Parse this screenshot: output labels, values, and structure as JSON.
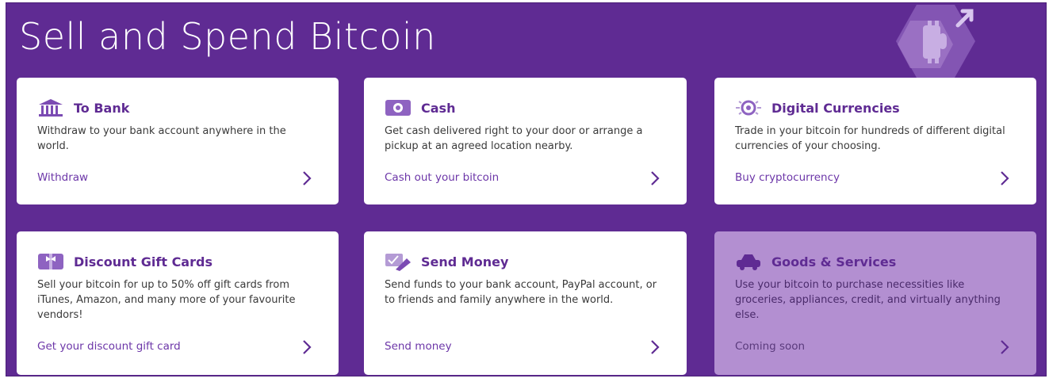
{
  "header": {
    "title": "Sell and Spend Bitcoin"
  },
  "colors": {
    "panel": "#5f2b93",
    "accent": "#6c36a8",
    "card": "#ffffff",
    "card_disabled": "#b38fd1"
  },
  "cards": [
    {
      "icon": "bank-icon",
      "title": "To Bank",
      "description": "Withdraw to your bank account anywhere in the world.",
      "link": "Withdraw"
    },
    {
      "icon": "cash-icon",
      "title": "Cash",
      "description": "Get cash delivered right to your door or arrange a pickup at an agreed location nearby.",
      "link": "Cash out your bitcoin"
    },
    {
      "icon": "digital-currency-icon",
      "title": "Digital Currencies",
      "description": "Trade in your bitcoin for hundreds of different digital currencies of your choosing.",
      "link": "Buy cryptocurrency"
    },
    {
      "icon": "gift-card-icon",
      "title": "Discount Gift Cards",
      "description": "Sell your bitcoin for up to 50% off gift cards from iTunes, Amazon, and many more of your favourite vendors!",
      "link": "Get your discount gift card"
    },
    {
      "icon": "send-money-icon",
      "title": "Send Money",
      "description": "Send funds to your bank account, PayPal account, or to friends and family anywhere in the world.",
      "link": "Send money"
    },
    {
      "icon": "car-icon",
      "title": "Goods & Services",
      "description": "Use your bitcoin to purchase necessities like groceries, appliances, credit, and virtually anything else.",
      "link": "Coming soon"
    }
  ]
}
